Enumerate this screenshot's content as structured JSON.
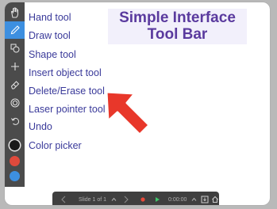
{
  "title": {
    "line1": "Simple Interface",
    "line2": "Tool Bar"
  },
  "tools": [
    {
      "label": "Hand tool",
      "icon": "hand-icon"
    },
    {
      "label": "Draw tool",
      "icon": "pencil-icon"
    },
    {
      "label": "Shape tool",
      "icon": "shapes-icon"
    },
    {
      "label": "Insert object tool",
      "icon": "plus-icon"
    },
    {
      "label": "Delete/Erase tool",
      "icon": "eraser-icon"
    },
    {
      "label": "Laser pointer tool",
      "icon": "laser-pointer-icon"
    },
    {
      "label": "Undo",
      "icon": "undo-icon"
    },
    {
      "label": "Color picker",
      "icon": "color-picker-icon"
    }
  ],
  "active_tool": "Draw tool",
  "colors": {
    "toolbar": "#4b4b4b",
    "active": "#3d8fe0",
    "label_text": "#3a3a9a",
    "title_text": "#5a3a9e",
    "arrow": "#e8372a"
  },
  "swatches": [
    "#1a1a1a",
    "#e04a3c",
    "#3d8fe0"
  ],
  "slide_bar": {
    "slide_indicator": "Slide 1 of 1",
    "timer": "0:00:00"
  }
}
